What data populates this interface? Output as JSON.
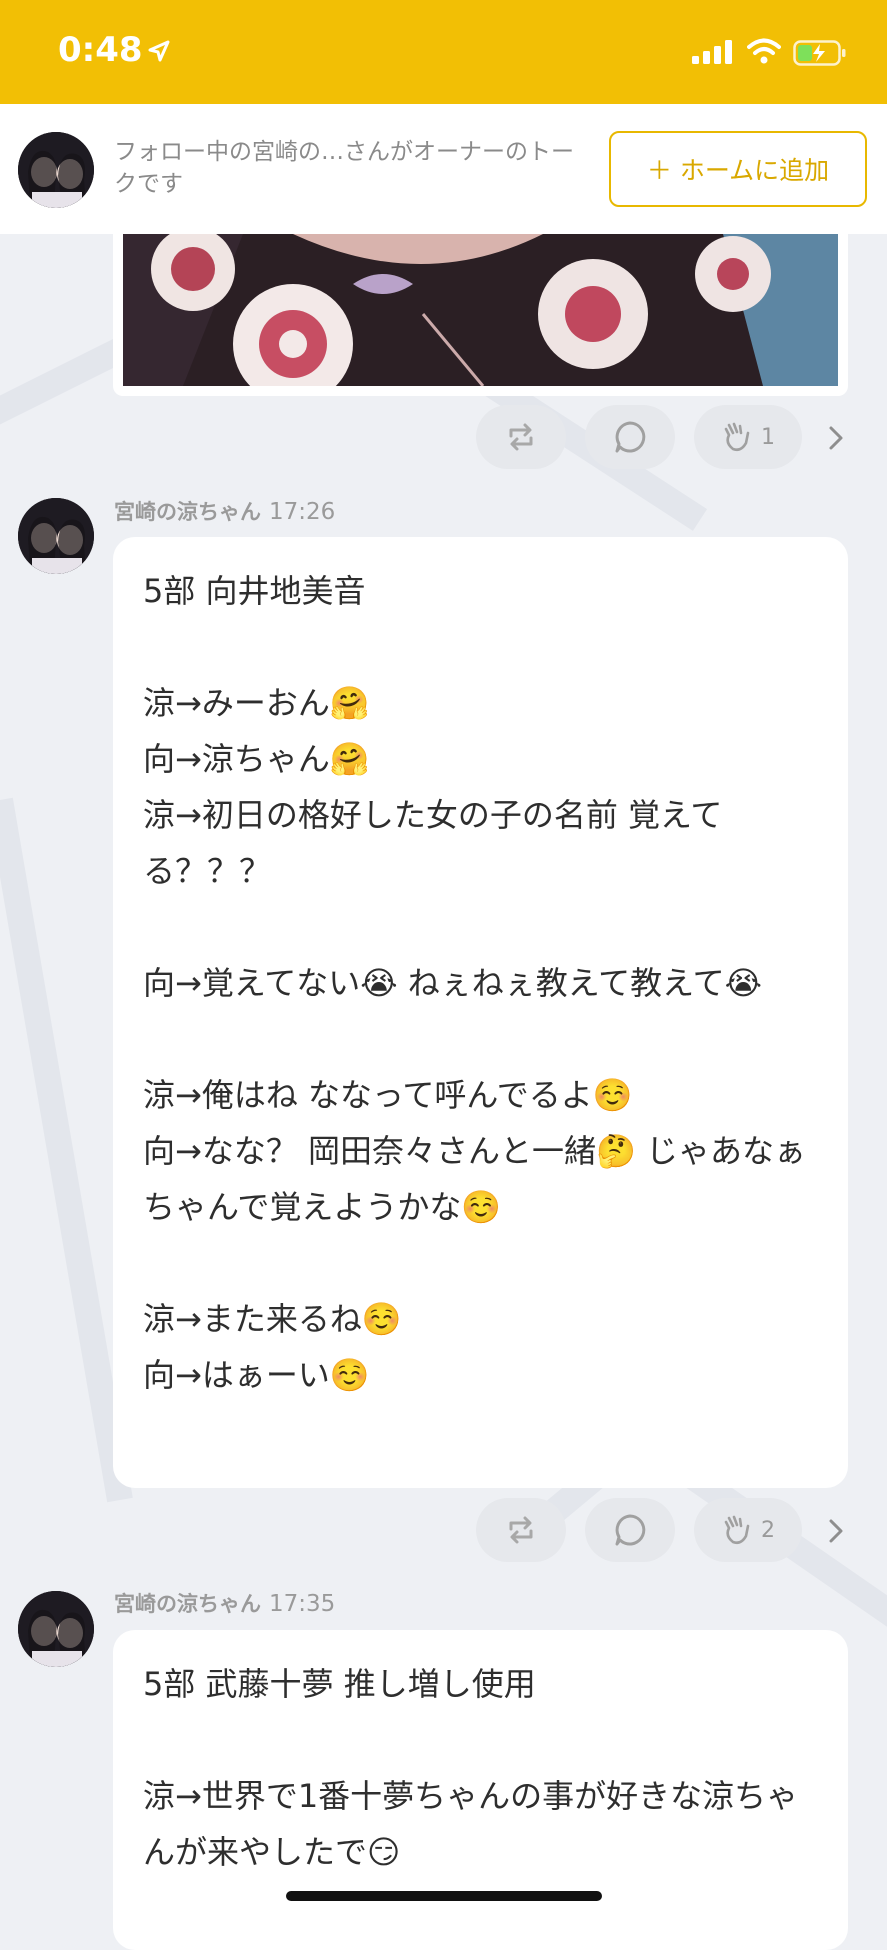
{
  "status_bar": {
    "time": "0:48",
    "icons": [
      "location-arrow-icon",
      "signal-icon",
      "wifi-icon",
      "battery-charging-icon"
    ]
  },
  "owner_bar": {
    "text": "フォロー中の宮崎の…さんがオーナーのトークです",
    "add_home_label": "＋ ホームに追加",
    "accent_color": "#e8b800"
  },
  "colors": {
    "status_bar_bg": "#f2bf05",
    "page_bg": "#eef0f4",
    "bubble_bg": "#ffffff"
  },
  "actions": [
    {
      "clap_count": "1"
    },
    {
      "clap_count": "2"
    }
  ],
  "messages": [
    {
      "author": "宮崎の涼ちゃん",
      "time": "17:26",
      "lines": [
        "5部 向井地美音",
        "",
        "涼→みーおん🤗",
        "向→涼ちゃん🤗",
        "涼→初日の格好した女の子の名前 覚えてる？？？",
        "",
        "向→覚えてない😭 ねぇねぇ教えて教えて😭",
        "",
        "涼→俺はね ななって呼んでるよ☺️",
        "向→なな？ 岡田奈々さんと一緒🤔 じゃあなぁちゃんで覚えようかな☺️",
        "",
        "涼→また来るね☺️",
        "向→はぁーい☺️"
      ]
    },
    {
      "author": "宮崎の涼ちゃん",
      "time": "17:35",
      "lines": [
        "5部 武藤十夢 推し増し使用",
        "",
        "涼→世界で1番十夢ちゃんの事が好きな涼ちゃんが来やしたで😏"
      ]
    }
  ]
}
